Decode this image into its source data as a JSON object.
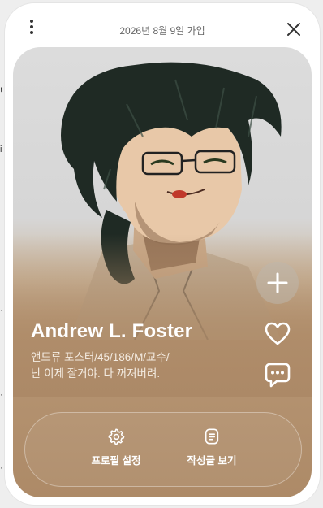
{
  "header": {
    "join_text": "2026년 8월 9일 가입"
  },
  "profile": {
    "name": "Andrew L. Foster",
    "description_line1": "앤드류 포스터/45/186/M/교수/",
    "description_line2": "난 이제 잘거야. 다 꺼져버려."
  },
  "actions": [
    {
      "label": "프로필 설정",
      "icon": "gear-icon"
    },
    {
      "label": "작성글 보기",
      "icon": "document-icon"
    }
  ],
  "side_buttons": [
    "plus-icon",
    "heart-icon",
    "chat-bubble-icon"
  ],
  "colors": {
    "card_bg": "#ffffff",
    "photo_bottom": "#ad8a67",
    "text_light": "#ffffff"
  }
}
